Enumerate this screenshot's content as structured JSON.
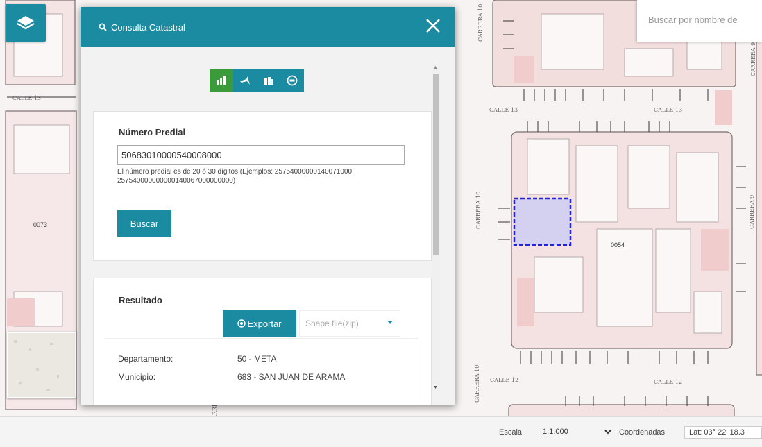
{
  "map": {
    "street_labels": [
      "CALLE 13",
      "CALLE 13",
      "CALLE 13",
      "CALLE 12",
      "CALLE 12",
      "CARRERA 10",
      "CARRERA 10",
      "CARRERA 9",
      "CARRERA 9",
      "CARRERA 10",
      "CARRERA 10"
    ],
    "block_labels": [
      "0073",
      "0054"
    ],
    "search_placeholder": "Buscar por nombre de"
  },
  "panel": {
    "title": "Consulta Catastral",
    "tabs": [
      {
        "icon": "bar-chart-icon",
        "active": true
      },
      {
        "icon": "pin-icon",
        "active": false
      },
      {
        "icon": "map-icon",
        "active": false
      },
      {
        "icon": "road-sign-icon",
        "active": false
      }
    ],
    "predial": {
      "label": "Número Predial",
      "value": "50683010000540008000",
      "help": "El número predial es de 20 ó 30 dígitos (Ejemplos: 25754000000140071000, 257540000000000140067000000000)",
      "button": "Buscar"
    },
    "result": {
      "title": "Resultado",
      "export_label": "Exportar",
      "format_value": "Shape file(zip)",
      "rows": [
        {
          "key": "Departamento:",
          "value": "50 - META"
        },
        {
          "key": "Municipio:",
          "value": "683 - SAN JUAN DE ARAMA"
        }
      ]
    }
  },
  "footer": {
    "scale_label": "Escala",
    "scale_value": "1:1.000",
    "coords_label": "Coordenadas",
    "coords_value": "Lat: 03° 22' 18.3"
  },
  "colors": {
    "accent": "#1a8ba0",
    "active_tab": "#3b9b3a",
    "selection": "#2222dd"
  }
}
